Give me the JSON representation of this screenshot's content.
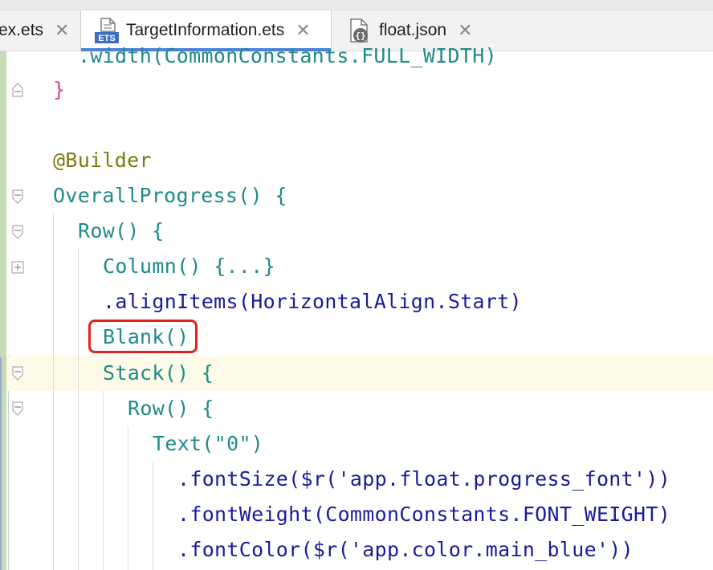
{
  "tabs": [
    {
      "label": "ex.ets",
      "icon": "ets-file-icon",
      "active": false
    },
    {
      "label": "TargetInformation.ets",
      "icon": "ets-file-icon",
      "active": true
    },
    {
      "label": "float.json",
      "icon": "json-file-icon",
      "active": false
    }
  ],
  "tab_icon_text": {
    "ets": "ETS",
    "json": "{}"
  },
  "close_glyph": "✕",
  "code": {
    "l0": ".width(CommonConstants.FULL_WIDTH)",
    "l1": "}",
    "l3": "@Builder",
    "l4": "OverallProgress() {",
    "l5": "Row() {",
    "l6": "Column() {...}",
    "l7": ".alignItems(HorizontalAlign.Start)",
    "l8": "Blank()",
    "l9": "Stack() {",
    "l10": "Row() {",
    "l11": "Text(\"0\")",
    "l12": ".fontSize($r('app.float.progress_font'))",
    "l13": ".fontWeight(CommonConstants.FONT_WEIGHT)",
    "l14": ".fontColor($r('app.color.main_blue'))"
  },
  "colors": {
    "highlight_box": "#e2231a",
    "active_tab_underline": "#4a82d8"
  }
}
